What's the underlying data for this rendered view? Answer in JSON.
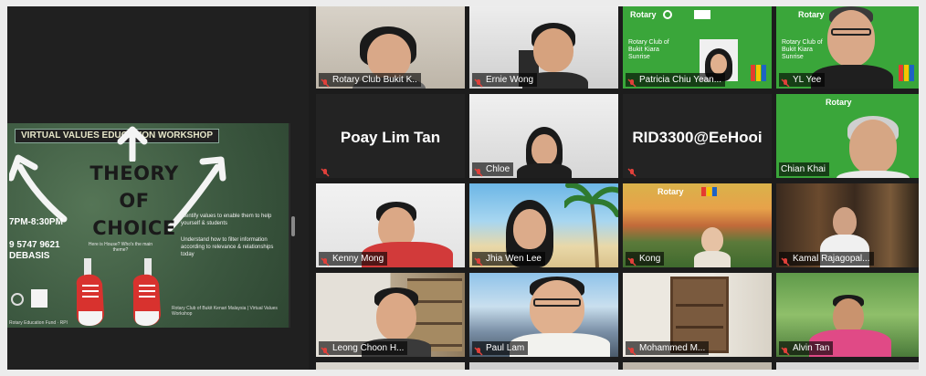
{
  "slide": {
    "banner": "VIRTUAL VALUES EDUCATION WORKSHOP",
    "title": [
      "THEORY",
      "OF",
      "CHOICE"
    ],
    "time": "7PM-8:30PM",
    "phone": "9 5747 9621\nDEBASIS",
    "subtitle": "Here is House? Who's the main theme?",
    "bullets": [
      "Identify values to enable them to help yourself & students",
      "Understand how to filter information according to relevance & relationships today"
    ],
    "footer": "Rotary Education Fund · RPI",
    "credits": "Rotary Club of Bukit Kenari Malaysia | Virtual Values Workshop"
  },
  "participants": [
    {
      "name": "Rotary Club Bukit K..."
    },
    {
      "name": "Ernie Wong"
    },
    {
      "name": "Patricia Chiu Yean..."
    },
    {
      "name": "YL Yee"
    },
    {
      "name": "Poay Lim Tan"
    },
    {
      "name": "Chloe"
    },
    {
      "name": "RID3300@EeHooi"
    },
    {
      "name": "Chian Khai"
    },
    {
      "name": "Kenny Mong"
    },
    {
      "name": "Jhia Wen Lee"
    },
    {
      "name": "Kong"
    },
    {
      "name": "Kamal Rajagopal..."
    },
    {
      "name": "Leong Choon H..."
    },
    {
      "name": "Paul Lam"
    },
    {
      "name": "Mohammed M..."
    },
    {
      "name": "Alvin Tan"
    }
  ],
  "rotary": {
    "logo": "Rotary",
    "club_text": "Rotary Club of Bukit Kiara Sunrise",
    "opportunities": "Rotary Opens Opportunities"
  },
  "colors": {
    "active_border": "#b8e34a",
    "rotary_green": "#3aa63a",
    "muted_mic": "#e0403a"
  }
}
